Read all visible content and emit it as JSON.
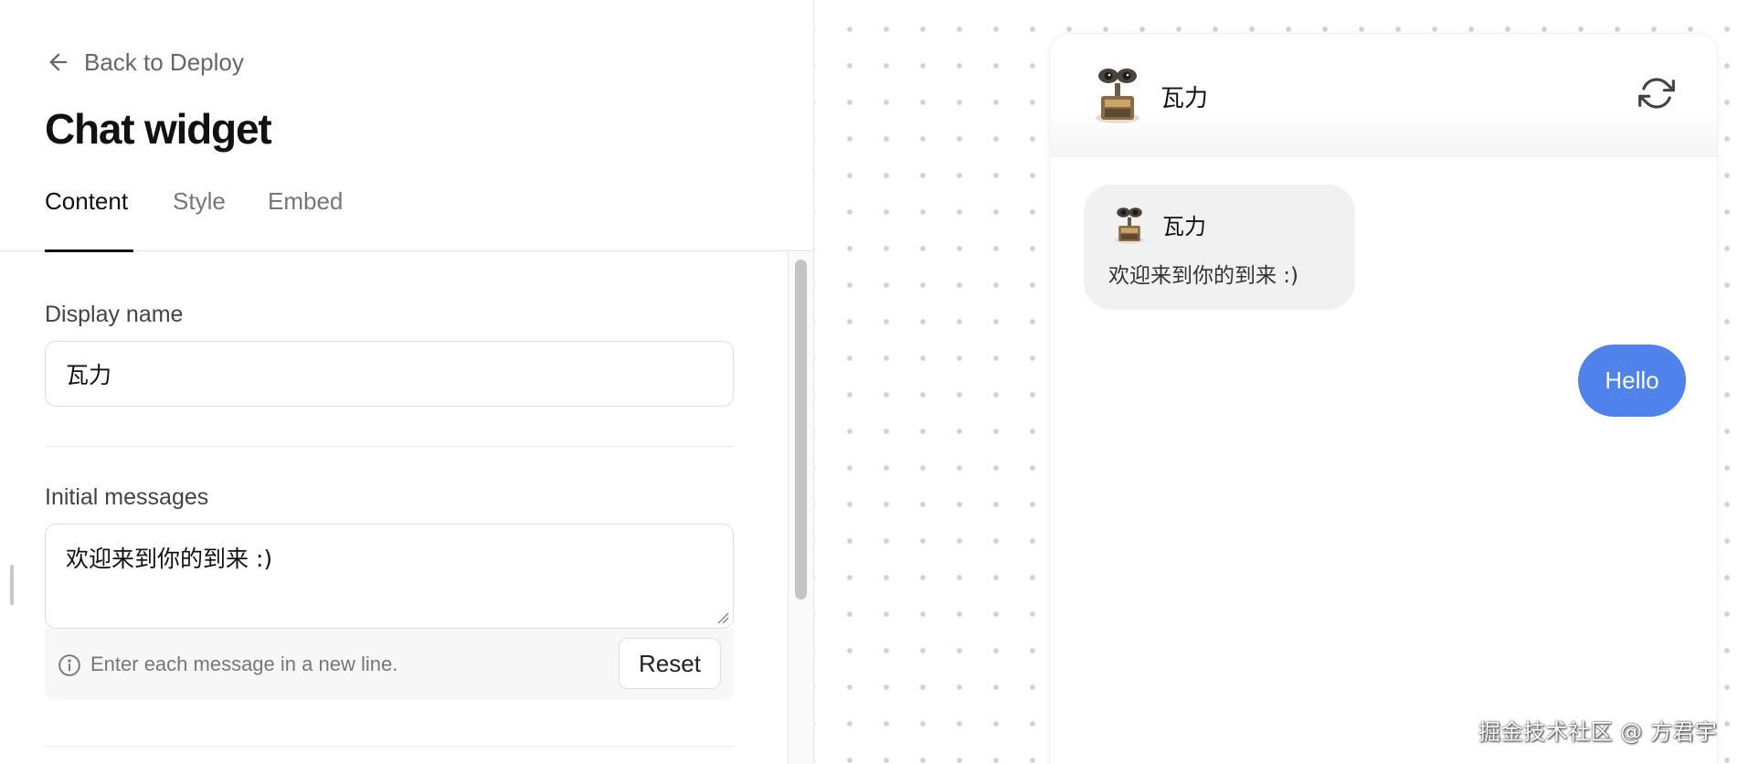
{
  "header": {
    "back_label": "Back to Deploy",
    "title": "Chat widget"
  },
  "tabs": [
    {
      "label": "Content",
      "active": true
    },
    {
      "label": "Style",
      "active": false
    },
    {
      "label": "Embed",
      "active": false
    }
  ],
  "form": {
    "display_name": {
      "label": "Display name",
      "value": "瓦力"
    },
    "initial_messages": {
      "label": "Initial messages",
      "value": "欢迎来到你的到来 :)",
      "hint": "Enter each message in a new line.",
      "reset_label": "Reset"
    }
  },
  "preview": {
    "bot_name": "瓦力",
    "messages": [
      {
        "from": "bot",
        "sender": "瓦力",
        "text": "欢迎来到你的到来 :)"
      },
      {
        "from": "user",
        "text": "Hello"
      }
    ],
    "user_bubble_color": "#4f82ea"
  },
  "watermark": "掘金技术社区 @ 方君宇",
  "icons": {
    "back": "arrow-left-icon",
    "refresh": "refresh-icon",
    "info": "info-icon"
  }
}
